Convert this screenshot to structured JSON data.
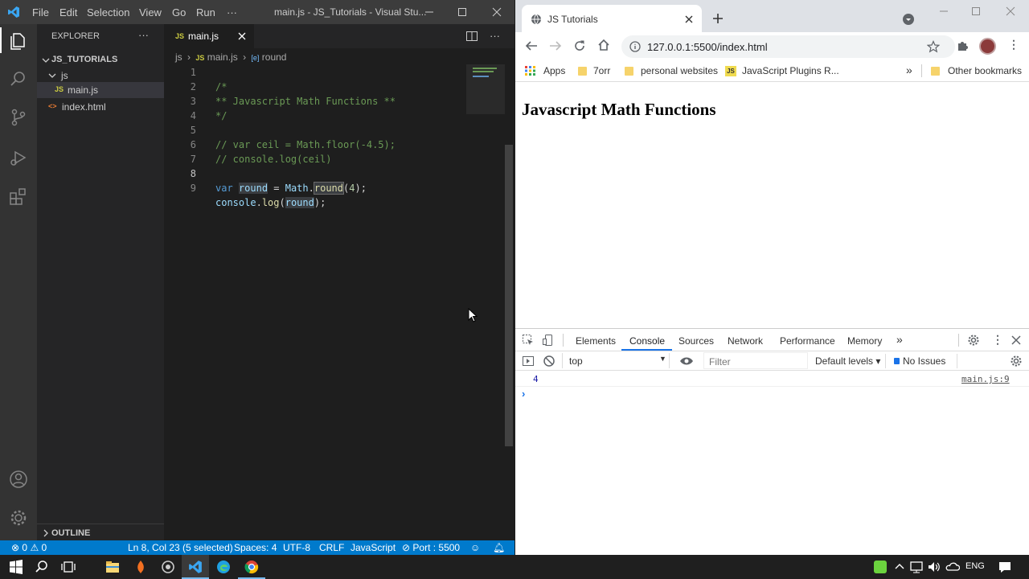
{
  "vscode": {
    "menu": [
      "File",
      "Edit",
      "Selection",
      "View",
      "Go",
      "Run",
      "···"
    ],
    "window_title": "main.js - JS_Tutorials - Visual Stu...",
    "sidebar": {
      "header": "EXPLORER",
      "more": "···",
      "root": "JS_TUTORIALS",
      "folder": "js",
      "file_main": "main.js",
      "file_index": "index.html",
      "outline": "OUTLINE",
      "js_badge": "JS",
      "html_badge": "<>"
    },
    "tab": {
      "label": "main.js",
      "badge": "JS"
    },
    "breadcrumb": {
      "folder": "js",
      "file": "main.js",
      "symbol": "round",
      "symbol_badge": "[e]"
    },
    "line_numbers": [
      "1",
      "2",
      "3",
      "4",
      "5",
      "6",
      "7",
      "8",
      "9"
    ],
    "code": {
      "l1": "/*",
      "l2": "** Javascript Math Functions **",
      "l3": "*/",
      "l5": "// var ceil = Math.floor(-4.5);",
      "l6": "// console.log(ceil)",
      "l8_kw": "var",
      "l8_var": "round",
      "l8_eq": " = ",
      "l8_obj": "Math",
      "l8_dot": ".",
      "l8_fn": "round",
      "l8_open": "(",
      "l8_num": "4",
      "l8_close": ");",
      "l9_obj": "console",
      "l9_dot": ".",
      "l9_fn": "log",
      "l9_open": "(",
      "l9_var": "round",
      "l9_close": ");"
    },
    "status": {
      "errors": "0",
      "warnings": "0",
      "position": "Ln 8, Col 23 (5 selected)",
      "spaces": "Spaces: 4",
      "encoding": "UTF-8",
      "eol": "CRLF",
      "language": "JavaScript",
      "port": "Port : 5500"
    }
  },
  "chrome": {
    "tab_title": "JS Tutorials",
    "url": "127.0.0.1:5500/index.html",
    "bookmarks": [
      "Apps",
      "7orr",
      "personal websites",
      "JavaScript Plugins R..."
    ],
    "bookmarks_more": "»",
    "other_bookmarks": "Other bookmarks",
    "js_badge": "JS",
    "page_heading": "Javascript Math Functions",
    "devtools": {
      "tabs": [
        "Elements",
        "Console",
        "Sources",
        "Network",
        "Performance",
        "Memory"
      ],
      "active_tab": "Console",
      "more_tabs": "»",
      "context": "top",
      "filter_placeholder": "Filter",
      "levels": "Default levels ▾",
      "issues": "No Issues",
      "log_value": "4",
      "log_source": "main.js:9",
      "prompt": "›"
    }
  },
  "taskbar": {
    "language": "ENG"
  },
  "colors": {
    "statusbar": "#007acc",
    "accent": "#1a73e8"
  }
}
